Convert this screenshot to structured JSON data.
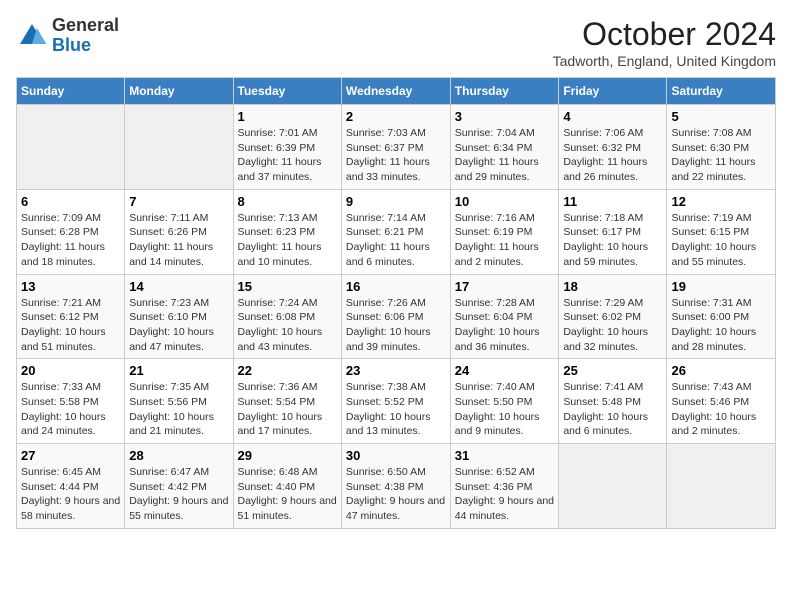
{
  "header": {
    "logo_general": "General",
    "logo_blue": "Blue",
    "month_title": "October 2024",
    "subtitle": "Tadworth, England, United Kingdom"
  },
  "days_of_week": [
    "Sunday",
    "Monday",
    "Tuesday",
    "Wednesday",
    "Thursday",
    "Friday",
    "Saturday"
  ],
  "weeks": [
    [
      {
        "day": "",
        "info": ""
      },
      {
        "day": "",
        "info": ""
      },
      {
        "day": "1",
        "info": "Sunrise: 7:01 AM\nSunset: 6:39 PM\nDaylight: 11 hours and 37 minutes."
      },
      {
        "day": "2",
        "info": "Sunrise: 7:03 AM\nSunset: 6:37 PM\nDaylight: 11 hours and 33 minutes."
      },
      {
        "day": "3",
        "info": "Sunrise: 7:04 AM\nSunset: 6:34 PM\nDaylight: 11 hours and 29 minutes."
      },
      {
        "day": "4",
        "info": "Sunrise: 7:06 AM\nSunset: 6:32 PM\nDaylight: 11 hours and 26 minutes."
      },
      {
        "day": "5",
        "info": "Sunrise: 7:08 AM\nSunset: 6:30 PM\nDaylight: 11 hours and 22 minutes."
      }
    ],
    [
      {
        "day": "6",
        "info": "Sunrise: 7:09 AM\nSunset: 6:28 PM\nDaylight: 11 hours and 18 minutes."
      },
      {
        "day": "7",
        "info": "Sunrise: 7:11 AM\nSunset: 6:26 PM\nDaylight: 11 hours and 14 minutes."
      },
      {
        "day": "8",
        "info": "Sunrise: 7:13 AM\nSunset: 6:23 PM\nDaylight: 11 hours and 10 minutes."
      },
      {
        "day": "9",
        "info": "Sunrise: 7:14 AM\nSunset: 6:21 PM\nDaylight: 11 hours and 6 minutes."
      },
      {
        "day": "10",
        "info": "Sunrise: 7:16 AM\nSunset: 6:19 PM\nDaylight: 11 hours and 2 minutes."
      },
      {
        "day": "11",
        "info": "Sunrise: 7:18 AM\nSunset: 6:17 PM\nDaylight: 10 hours and 59 minutes."
      },
      {
        "day": "12",
        "info": "Sunrise: 7:19 AM\nSunset: 6:15 PM\nDaylight: 10 hours and 55 minutes."
      }
    ],
    [
      {
        "day": "13",
        "info": "Sunrise: 7:21 AM\nSunset: 6:12 PM\nDaylight: 10 hours and 51 minutes."
      },
      {
        "day": "14",
        "info": "Sunrise: 7:23 AM\nSunset: 6:10 PM\nDaylight: 10 hours and 47 minutes."
      },
      {
        "day": "15",
        "info": "Sunrise: 7:24 AM\nSunset: 6:08 PM\nDaylight: 10 hours and 43 minutes."
      },
      {
        "day": "16",
        "info": "Sunrise: 7:26 AM\nSunset: 6:06 PM\nDaylight: 10 hours and 39 minutes."
      },
      {
        "day": "17",
        "info": "Sunrise: 7:28 AM\nSunset: 6:04 PM\nDaylight: 10 hours and 36 minutes."
      },
      {
        "day": "18",
        "info": "Sunrise: 7:29 AM\nSunset: 6:02 PM\nDaylight: 10 hours and 32 minutes."
      },
      {
        "day": "19",
        "info": "Sunrise: 7:31 AM\nSunset: 6:00 PM\nDaylight: 10 hours and 28 minutes."
      }
    ],
    [
      {
        "day": "20",
        "info": "Sunrise: 7:33 AM\nSunset: 5:58 PM\nDaylight: 10 hours and 24 minutes."
      },
      {
        "day": "21",
        "info": "Sunrise: 7:35 AM\nSunset: 5:56 PM\nDaylight: 10 hours and 21 minutes."
      },
      {
        "day": "22",
        "info": "Sunrise: 7:36 AM\nSunset: 5:54 PM\nDaylight: 10 hours and 17 minutes."
      },
      {
        "day": "23",
        "info": "Sunrise: 7:38 AM\nSunset: 5:52 PM\nDaylight: 10 hours and 13 minutes."
      },
      {
        "day": "24",
        "info": "Sunrise: 7:40 AM\nSunset: 5:50 PM\nDaylight: 10 hours and 9 minutes."
      },
      {
        "day": "25",
        "info": "Sunrise: 7:41 AM\nSunset: 5:48 PM\nDaylight: 10 hours and 6 minutes."
      },
      {
        "day": "26",
        "info": "Sunrise: 7:43 AM\nSunset: 5:46 PM\nDaylight: 10 hours and 2 minutes."
      }
    ],
    [
      {
        "day": "27",
        "info": "Sunrise: 6:45 AM\nSunset: 4:44 PM\nDaylight: 9 hours and 58 minutes."
      },
      {
        "day": "28",
        "info": "Sunrise: 6:47 AM\nSunset: 4:42 PM\nDaylight: 9 hours and 55 minutes."
      },
      {
        "day": "29",
        "info": "Sunrise: 6:48 AM\nSunset: 4:40 PM\nDaylight: 9 hours and 51 minutes."
      },
      {
        "day": "30",
        "info": "Sunrise: 6:50 AM\nSunset: 4:38 PM\nDaylight: 9 hours and 47 minutes."
      },
      {
        "day": "31",
        "info": "Sunrise: 6:52 AM\nSunset: 4:36 PM\nDaylight: 9 hours and 44 minutes."
      },
      {
        "day": "",
        "info": ""
      },
      {
        "day": "",
        "info": ""
      }
    ]
  ]
}
